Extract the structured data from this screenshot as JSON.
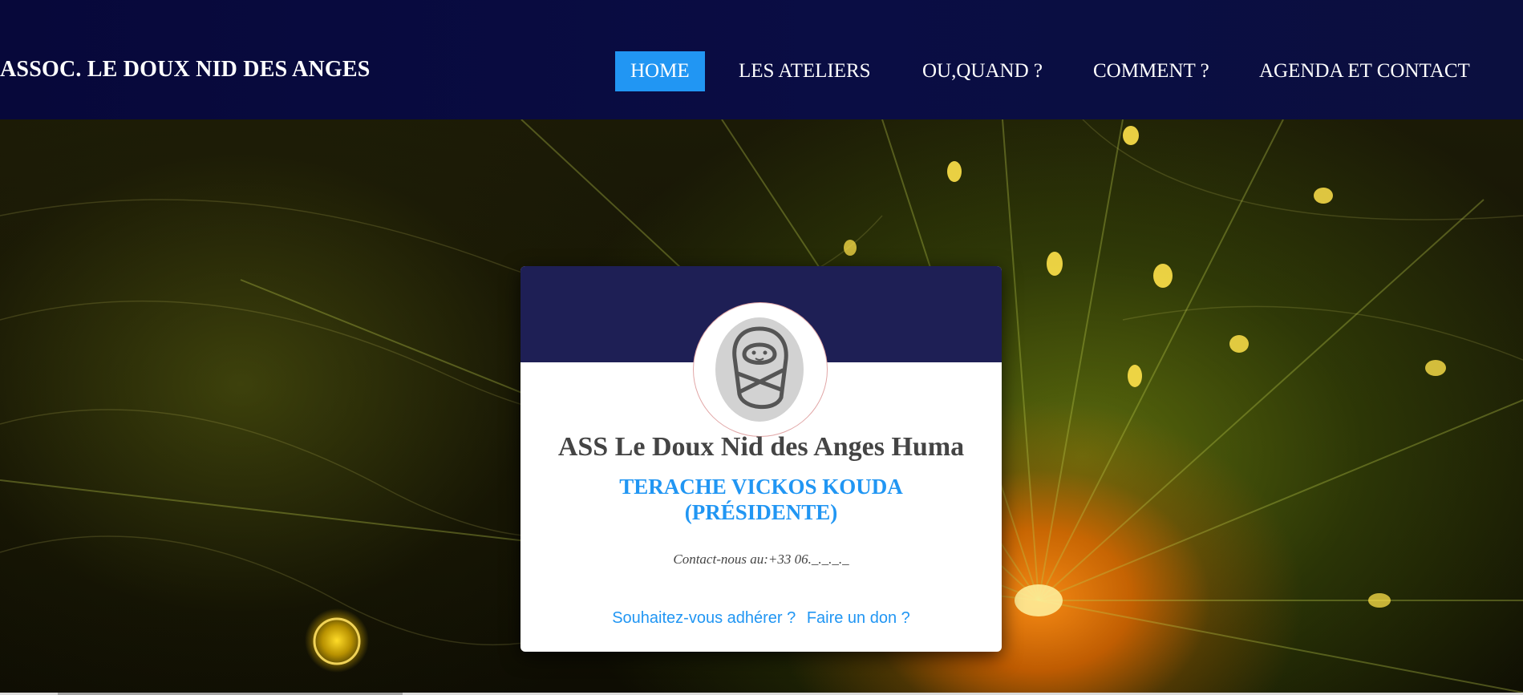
{
  "header": {
    "brand": "ASSOC. LE DOUX NID DES ANGES",
    "nav": [
      {
        "label": "HOME",
        "active": true
      },
      {
        "label": "LES ATELIERS",
        "active": false
      },
      {
        "label": "OU,QUAND ?",
        "active": false
      },
      {
        "label": "COMMENT ?",
        "active": false
      },
      {
        "label": "AGENDA ET CONTACT",
        "active": false
      }
    ]
  },
  "card": {
    "avatar_icon": "swaddled-baby-icon",
    "title": "ASS Le Doux Nid des Anges Huma",
    "subtitle_line1": "TERACHE VICKOS KOUDA",
    "subtitle_line2": "(PRÉSIDENTE)",
    "contact": "Contact-nous au:+33 06._._._._",
    "link_join": "Souhaitez-vous adhérer ?",
    "link_donate": "Faire un don ?"
  },
  "colors": {
    "header_bg": "#0a0d44",
    "nav_active": "#2196f3",
    "card_top": "#1e1f55",
    "link": "#2196f3"
  }
}
